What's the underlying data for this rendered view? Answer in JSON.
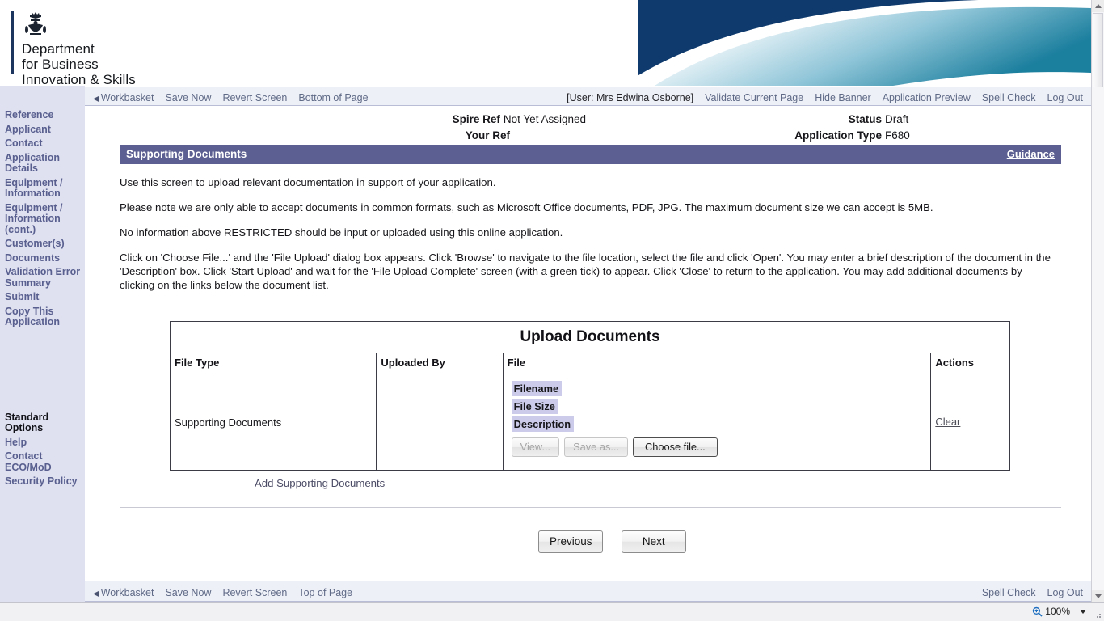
{
  "banner": {
    "logo_lines": [
      "Department",
      "for Business",
      "Innovation & Skills"
    ],
    "crest_alt": "royal-crest",
    "navy_color": "#0e3a6e",
    "swoosh_color": "#1f7f9c"
  },
  "topnav": {
    "left_items": [
      {
        "label": "Workbasket",
        "arrow": true
      },
      {
        "label": "Save Now",
        "arrow": false
      },
      {
        "label": "Revert Screen",
        "arrow": false
      },
      {
        "label": "Bottom of Page",
        "arrow": false
      }
    ],
    "user_label": "[User: Mrs Edwina Osborne]",
    "right_items": [
      {
        "label": "Validate Current Page"
      },
      {
        "label": "Hide Banner"
      },
      {
        "label": "Application Preview"
      },
      {
        "label": "Spell Check"
      },
      {
        "label": "Log Out"
      }
    ]
  },
  "sidebar": {
    "items": [
      {
        "label": "Reference"
      },
      {
        "label": "Applicant"
      },
      {
        "label": "Contact"
      },
      {
        "label": "Application Details"
      },
      {
        "label": "Equipment / Information"
      },
      {
        "label": "Equipment / Information (cont.)"
      },
      {
        "label": "Customer(s)"
      },
      {
        "label": "Documents"
      },
      {
        "label": "Validation Error Summary"
      },
      {
        "label": "Submit"
      },
      {
        "label": "Copy This Application"
      }
    ],
    "standard_options_heading": "Standard Options",
    "standard_options": [
      {
        "label": "Help"
      },
      {
        "label": "Contact ECO/MoD"
      },
      {
        "label": "Security Policy"
      }
    ],
    "text_color": "#59608f",
    "background_color": "#dfe0f0"
  },
  "header_info": {
    "spire_ref_label": "Spire Ref",
    "spire_ref_value": "Not Yet Assigned",
    "your_ref_label": "Your Ref",
    "your_ref_value": "",
    "status_label": "Status",
    "status_value": "Draft",
    "application_type_label": "Application Type",
    "application_type_value": "F680"
  },
  "section": {
    "title": "Supporting Documents",
    "guidance_label": "Guidance",
    "bar_color": "#5c5f91"
  },
  "instructions": [
    "Use this screen to upload relevant documentation in support of your application.",
    "Please note we are only able to accept documents in common formats, such as Microsoft Office documents, PDF, JPG. The maximum document size we can accept is 5MB.",
    "No information above RESTRICTED should be input or uploaded using this online application.",
    "Click on 'Choose File...' and the 'File Upload' dialog box appears. Click 'Browse' to navigate to the file location, select the file and click 'Open'. You may enter a brief description of the document in the 'Description' box. Click 'Start Upload' and wait for the 'File Upload Complete' screen (with a green tick) to appear. Click 'Close' to return to the application. You may add additional documents by clicking on the links below the document list."
  ],
  "upload_table": {
    "title": "Upload Documents",
    "columns": [
      "File Type",
      "Uploaded By",
      "File",
      "Actions"
    ],
    "rows": [
      {
        "file_type": "Supporting Documents",
        "uploaded_by": "",
        "file_fields": [
          {
            "label": "Filename",
            "value": ""
          },
          {
            "label": "File Size",
            "value": ""
          },
          {
            "label": "Description",
            "value": ""
          }
        ],
        "file_buttons": [
          {
            "label": "View...",
            "disabled": true
          },
          {
            "label": "Save as...",
            "disabled": true
          },
          {
            "label": "Choose file...",
            "disabled": false
          }
        ],
        "action_label": "Clear"
      }
    ],
    "add_link_label": "Add Supporting Documents"
  },
  "page_nav": {
    "previous_label": "Previous",
    "next_label": "Next"
  },
  "bottomnav": {
    "left_items": [
      {
        "label": "Workbasket",
        "arrow": true
      },
      {
        "label": "Save Now",
        "arrow": false
      },
      {
        "label": "Revert Screen",
        "arrow": false
      },
      {
        "label": "Top of Page",
        "arrow": false
      }
    ],
    "right_items": [
      {
        "label": "Spell Check"
      },
      {
        "label": "Log Out"
      }
    ]
  },
  "statusbar": {
    "zoom_icon": "magnifier-plus-icon",
    "zoom_level": "100%"
  }
}
